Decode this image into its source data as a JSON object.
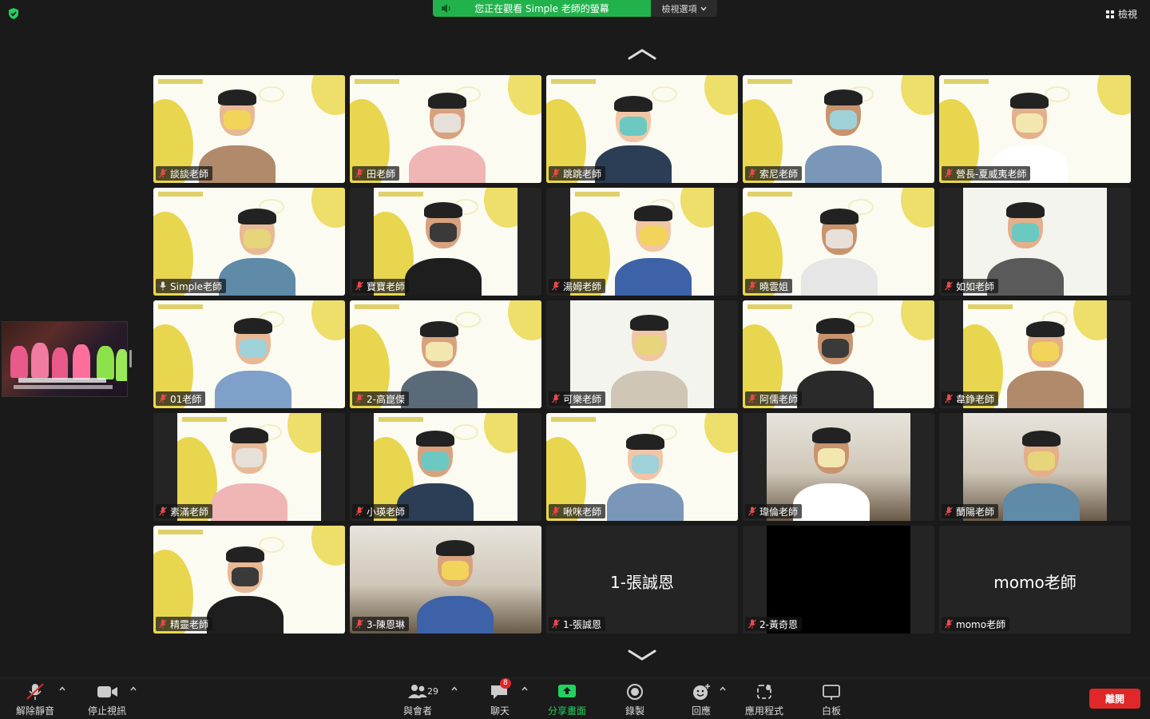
{
  "top_bar": {
    "share_banner": "您正在觀看 Simple 老師的螢幕",
    "view_options": "檢視選項",
    "view_label": "檢視"
  },
  "participants": [
    {
      "name": "談談老師",
      "mic": "muted",
      "bg": "yellow",
      "active": true
    },
    {
      "name": "田老師",
      "mic": "muted",
      "bg": "yellow"
    },
    {
      "name": "跳跳老師",
      "mic": "muted",
      "bg": "yellow"
    },
    {
      "name": "索尼老師",
      "mic": "muted",
      "bg": "yellow"
    },
    {
      "name": "營長-夏威夷老師",
      "mic": "muted",
      "bg": "yellow"
    },
    {
      "name": "Simple老師",
      "mic": "on",
      "bg": "yellow"
    },
    {
      "name": "寶寶老師",
      "mic": "muted",
      "bg": "yellow-narrow"
    },
    {
      "name": "湯姆老師",
      "mic": "muted",
      "bg": "yellow-narrow"
    },
    {
      "name": "曉雲姐",
      "mic": "muted",
      "bg": "yellow"
    },
    {
      "name": "如如老師",
      "mic": "muted",
      "bg": "white-narrow"
    },
    {
      "name": "01老師",
      "mic": "muted",
      "bg": "yellow"
    },
    {
      "name": "2-高崑傑",
      "mic": "muted",
      "bg": "yellow"
    },
    {
      "name": "可樂老師",
      "mic": "muted",
      "bg": "white-narrow"
    },
    {
      "name": "阿儒老師",
      "mic": "muted",
      "bg": "yellow"
    },
    {
      "name": "韋錚老師",
      "mic": "muted",
      "bg": "yellow-narrow"
    },
    {
      "name": "素滿老師",
      "mic": "muted",
      "bg": "yellow-narrow"
    },
    {
      "name": "小瑛老師",
      "mic": "muted",
      "bg": "yellow-narrow"
    },
    {
      "name": "啾咪老師",
      "mic": "muted",
      "bg": "yellow"
    },
    {
      "name": "瑋倫老師",
      "mic": "muted",
      "bg": "room-narrow"
    },
    {
      "name": "蘭陽老師",
      "mic": "muted",
      "bg": "room-narrow"
    },
    {
      "name": "精靈老師",
      "mic": "muted",
      "bg": "yellow"
    },
    {
      "name": "3-陳恩琳",
      "mic": "muted",
      "bg": "room"
    },
    {
      "name": "1-張誠恩",
      "mic": "muted",
      "bg": "none",
      "center_name": "1-張誠恩"
    },
    {
      "name": "2-黃奇恩",
      "mic": "muted",
      "bg": "black-narrow"
    },
    {
      "name": "momo老師",
      "mic": "muted",
      "bg": "none",
      "center_name": "momo老師"
    }
  ],
  "toolbar": {
    "unmute": "解除靜音",
    "stop_video": "停止視訊",
    "participants": "與會者",
    "participants_count": "29",
    "chat": "聊天",
    "chat_badge": "8",
    "share": "分享畫面",
    "record": "錄製",
    "reactions": "回應",
    "apps": "應用程式",
    "whiteboard": "白板",
    "leave": "離開"
  },
  "colors": {
    "accent_green": "#22b24c",
    "leave_red": "#e02828",
    "bg_yellow": "#e9d64f"
  }
}
